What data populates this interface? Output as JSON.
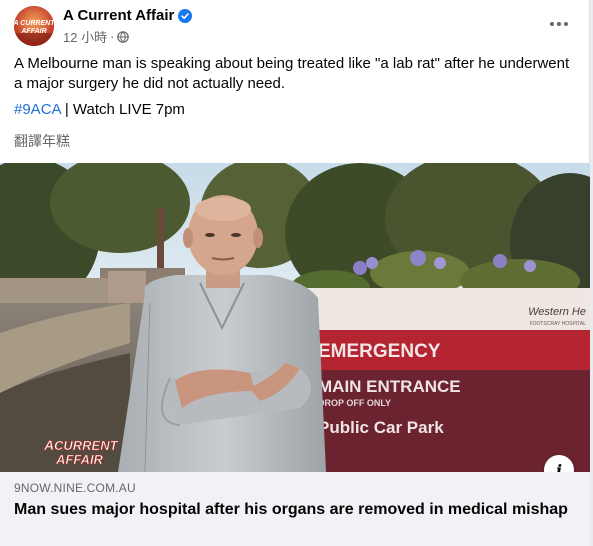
{
  "post": {
    "page_name": "A Current Affair",
    "timestamp": "12 小時",
    "separator": "·",
    "text": "A Melbourne man is speaking about being treated like \"a lab rat\" after he underwent a major surgery he did not actually need.",
    "hashtag": "#9ACA",
    "tag_suffix": " | Watch LIVE 7pm",
    "translate_label": "翻譯年糕"
  },
  "avatar": {
    "logo_text": "A CURRENT AFFAIR",
    "colors": {
      "bg": "#c23c2a",
      "text": "#ffffff"
    }
  },
  "media": {
    "signage": {
      "brand": "Western He",
      "sub": "FOOTSCRAY HOSPITAL",
      "line1": "EMERGENCY",
      "line2": "MAIN ENTRANCE",
      "line3": "DROP OFF ONLY",
      "line4": "Public Car Park"
    },
    "watermark": "A CURRENT AFFAIR",
    "info_label": "i"
  },
  "link_preview": {
    "domain": "9NOW.NINE.COM.AU",
    "title": "Man sues major hospital after his organs are removed in medical mishap"
  },
  "colors": {
    "accent": "#1877f2",
    "hashtag": "#216fdb",
    "sign_red": "#b42431",
    "sign_maroon": "#5a1c28"
  },
  "icons": {
    "verified": "verified-badge-icon",
    "privacy": "globe-icon",
    "more": "more-dots-icon",
    "info": "info-icon"
  }
}
